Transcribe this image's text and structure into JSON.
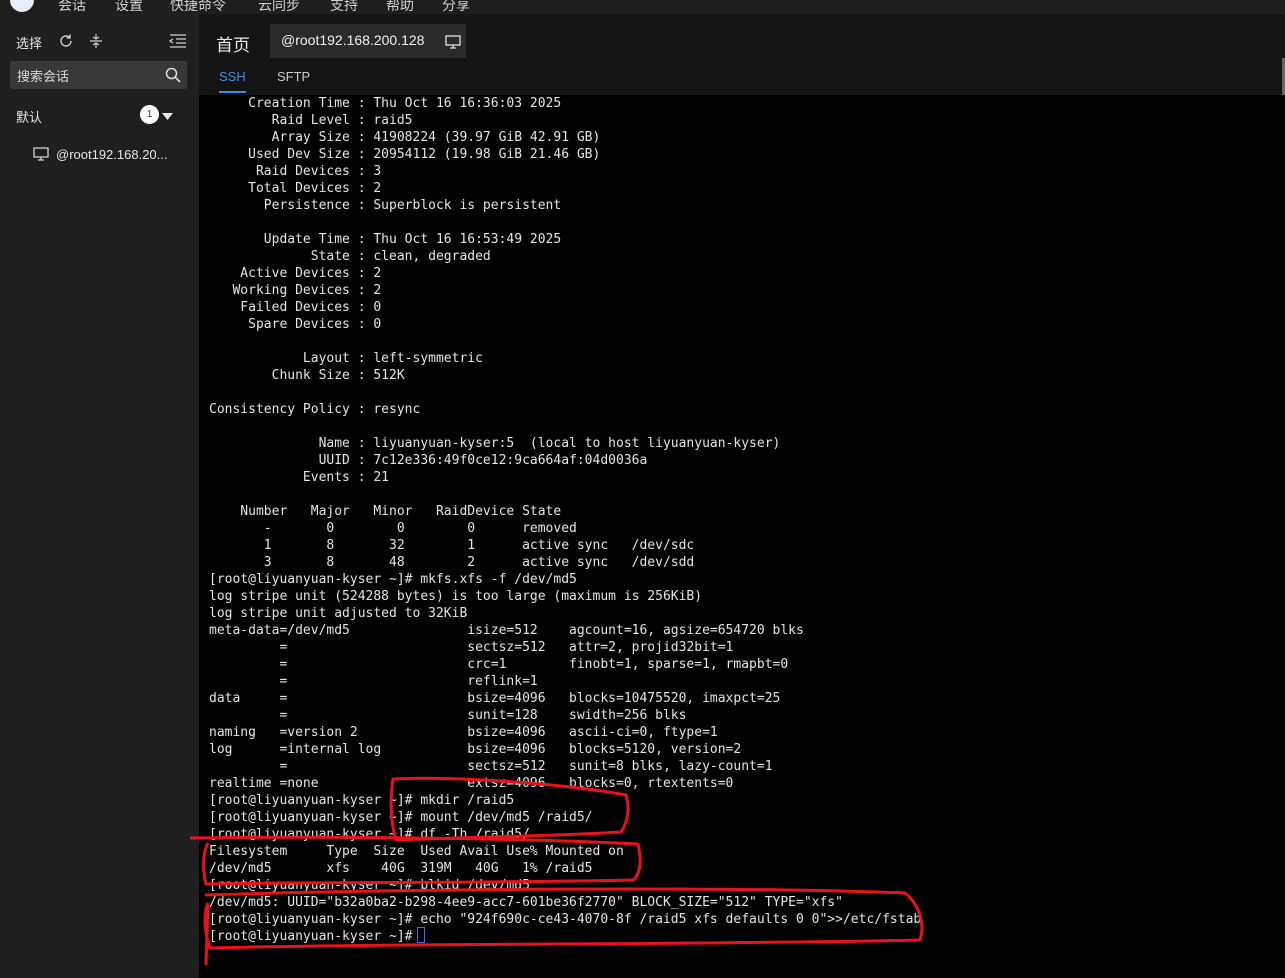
{
  "app": {
    "menu": [
      "会话",
      "设置",
      "快捷命令",
      "云同步",
      "支持",
      "帮助",
      "分享"
    ]
  },
  "sidebar": {
    "select_label": "选择",
    "search_placeholder": "搜索会话",
    "group_label": "默认",
    "group_count": "1",
    "session_item": "@root192.168.20..."
  },
  "tabs": {
    "home": "首页",
    "session": "@root192.168.200.128"
  },
  "subtabs": [
    "SSH",
    "SFTP"
  ],
  "terminal": {
    "lines": [
      "     Creation Time : Thu Oct 16 16:36:03 2025",
      "        Raid Level : raid5",
      "        Array Size : 41908224 (39.97 GiB 42.91 GB)",
      "     Used Dev Size : 20954112 (19.98 GiB 21.46 GB)",
      "      Raid Devices : 3",
      "     Total Devices : 2",
      "       Persistence : Superblock is persistent",
      "",
      "       Update Time : Thu Oct 16 16:53:49 2025",
      "             State : clean, degraded",
      "    Active Devices : 2",
      "   Working Devices : 2",
      "    Failed Devices : 0",
      "     Spare Devices : 0",
      "",
      "            Layout : left-symmetric",
      "        Chunk Size : 512K",
      "",
      "Consistency Policy : resync",
      "",
      "              Name : liyuanyuan-kyser:5  (local to host liyuanyuan-kyser)",
      "              UUID : 7c12e336:49f0ce12:9ca664af:04d0036a",
      "            Events : 21",
      "",
      "    Number   Major   Minor   RaidDevice State",
      "       -       0        0        0      removed",
      "       1       8       32        1      active sync   /dev/sdc",
      "       3       8       48        2      active sync   /dev/sdd",
      "[root@liyuanyuan-kyser ~]# mkfs.xfs -f /dev/md5",
      "log stripe unit (524288 bytes) is too large (maximum is 256KiB)",
      "log stripe unit adjusted to 32KiB",
      "meta-data=/dev/md5               isize=512    agcount=16, agsize=654720 blks",
      "         =                       sectsz=512   attr=2, projid32bit=1",
      "         =                       crc=1        finobt=1, sparse=1, rmapbt=0",
      "         =                       reflink=1",
      "data     =                       bsize=4096   blocks=10475520, imaxpct=25",
      "         =                       sunit=128    swidth=256 blks",
      "naming   =version 2              bsize=4096   ascii-ci=0, ftype=1",
      "log      =internal log           bsize=4096   blocks=5120, version=2",
      "         =                       sectsz=512   sunit=8 blks, lazy-count=1",
      "realtime =none                   extsz=4096   blocks=0, rtextents=0",
      "[root@liyuanyuan-kyser ~]# mkdir /raid5",
      "[root@liyuanyuan-kyser ~]# mount /dev/md5 /raid5/",
      "[root@liyuanyuan-kyser ~]# df -Th /raid5/",
      "Filesystem     Type  Size  Used Avail Use% Mounted on",
      "/dev/md5       xfs    40G  319M   40G   1% /raid5",
      "[root@liyuanyuan-kyser ~]# blkid /dev/md5",
      "/dev/md5: UUID=\"b32a0ba2-b298-4ee9-acc7-601be36f2770\" BLOCK_SIZE=\"512\" TYPE=\"xfs\"",
      "[root@liyuanyuan-kyser ~]# echo \"924f690c-ce43-4070-8f /raid5 xfs defaults 0 0\">>/etc/fstab",
      "[root@liyuanyuan-kyser ~]# "
    ]
  },
  "colors": {
    "accent": "#3d8ee6",
    "annotation": "#e8131a"
  }
}
